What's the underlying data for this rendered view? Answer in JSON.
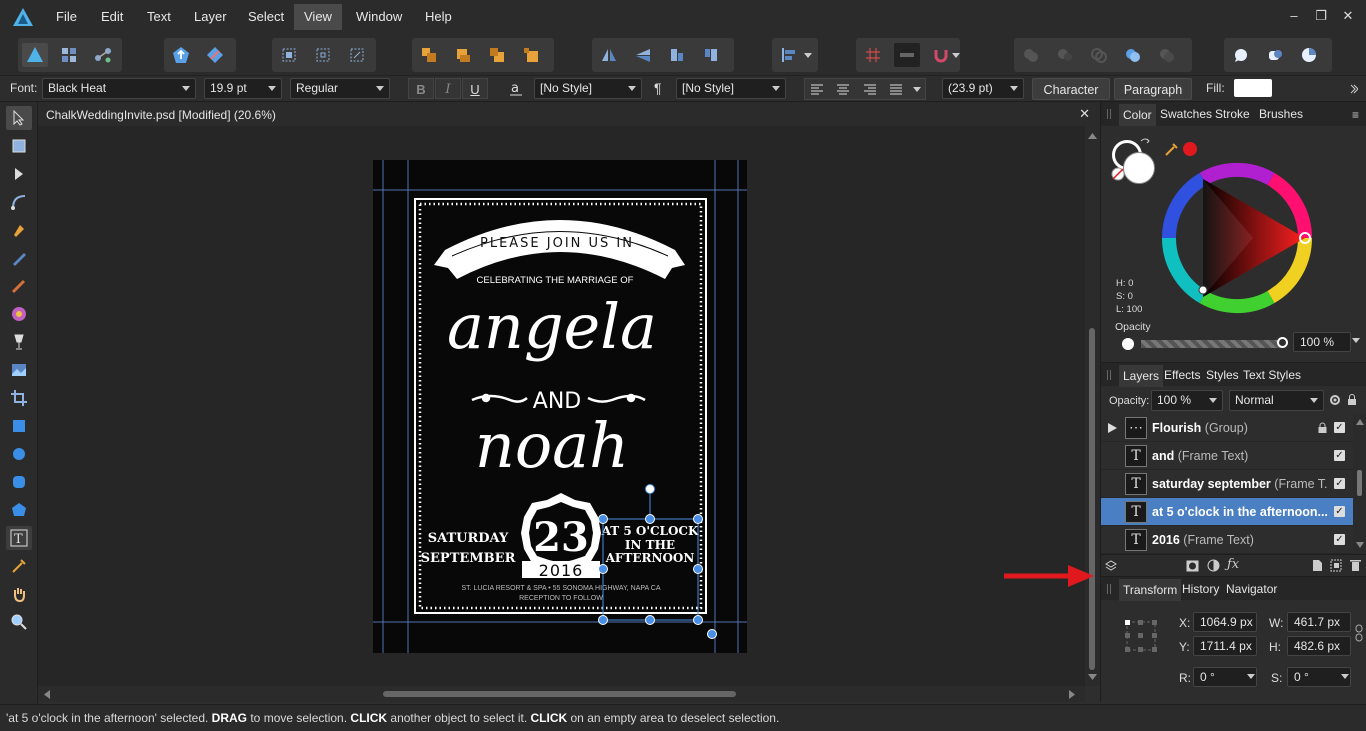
{
  "menu": {
    "items": [
      "File",
      "Edit",
      "Text",
      "Layer",
      "Select",
      "View",
      "Window",
      "Help"
    ],
    "active": "View"
  },
  "window_controls": {
    "minimize": "–",
    "restore": "❐",
    "close": "✕"
  },
  "context_toolbar": {
    "font_label": "Font:",
    "font_family": "Black Heat",
    "font_size": "19.9 pt",
    "font_style": "Regular",
    "bold": "B",
    "italic": "I",
    "underline": "U",
    "char_style": "[No Style]",
    "para_style": "[No Style]",
    "leading": "(23.9 pt)",
    "character_button": "Character",
    "paragraph_button": "Paragraph",
    "fill_label": "Fill:",
    "fill_color": "#ffffff"
  },
  "document": {
    "tab_title": "ChalkWeddingInvite.psd [Modified] (20.6%)",
    "close": "✕"
  },
  "invite": {
    "please": "PLEASE JOIN US IN",
    "celebrating": "CELEBRATING THE MARRIAGE OF",
    "name1": "angela",
    "and": "AND",
    "name2": "noah",
    "saturday": "SATURDAY",
    "september": "SEPTEMBER",
    "day": "23",
    "year": "2016",
    "at5_line1": "AT 5 O'CLOCK",
    "at5_line2": "IN THE",
    "at5_line3": "AFTERNOON",
    "venue": "ST. LUCIA RESORT & SPA • 55 SONOMA HIGHWAY, NAPA CA",
    "reception": "RECEPTION TO FOLLOW"
  },
  "color_panel": {
    "tabs": [
      "Color",
      "Swatches",
      "Stroke",
      "Brushes"
    ],
    "active_tab": "Color",
    "h": "H: 0",
    "s": "S: 0",
    "l": "L: 100",
    "opacity_label": "Opacity",
    "opacity_value": "100 %",
    "accent_red": "#e0191e"
  },
  "layers_panel": {
    "tabs": [
      "Layers",
      "Effects",
      "Styles",
      "Text Styles"
    ],
    "active_tab": "Layers",
    "opacity_label": "Opacity:",
    "opacity_value": "100 %",
    "blend_mode": "Normal",
    "layers": [
      {
        "name": "Flourish",
        "type": " (Group)",
        "thumb": "⋯",
        "selected": false,
        "expander": true,
        "locked": true
      },
      {
        "name": "and",
        "type": " (Frame Text)",
        "thumb": "T",
        "selected": false,
        "expander": false,
        "locked": false
      },
      {
        "name": "saturday september",
        "type": " (Frame T...",
        "thumb": "T",
        "selected": false,
        "expander": false,
        "locked": false
      },
      {
        "name": "at 5 o'clock in the afternoon...",
        "type": "",
        "thumb": "T",
        "selected": true,
        "expander": false,
        "locked": false
      },
      {
        "name": "2016",
        "type": " (Frame Text)",
        "thumb": "T",
        "selected": false,
        "expander": false,
        "locked": false
      }
    ]
  },
  "transform_panel": {
    "tabs": [
      "Transform",
      "History",
      "Navigator"
    ],
    "active_tab": "Transform",
    "x_label": "X:",
    "x_value": "1064.9 px",
    "y_label": "Y:",
    "y_value": "1711.4 px",
    "w_label": "W:",
    "w_value": "461.7 px",
    "h_label": "H:",
    "h_value": "482.6 px",
    "r_label": "R:",
    "r_value": "0 °",
    "s_label": "S:",
    "s_value": "0 °"
  },
  "status": {
    "prefix": "'at 5 o'clock in the afternoon' selected. ",
    "drag": "DRAG",
    "mid1": " to move selection. ",
    "click1": "CLICK",
    "mid2": " another object to select it. ",
    "click2": "CLICK",
    "suffix": " on an empty area to deselect selection."
  }
}
